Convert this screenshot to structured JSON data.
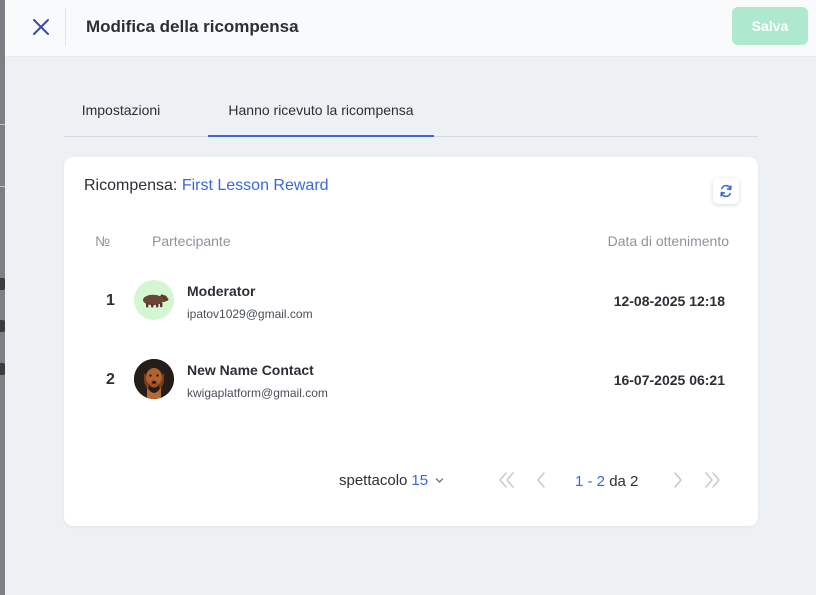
{
  "header": {
    "title": "Modifica della ricompensa",
    "save_label": "Salva"
  },
  "tabs": [
    {
      "label": "Impostazioni",
      "active": false
    },
    {
      "label": "Hanno ricevuto la ricompensa",
      "active": true
    }
  ],
  "reward": {
    "label": "Ricompensa:",
    "name": "First Lesson Reward"
  },
  "table": {
    "columns": {
      "number": "№",
      "participant": "Partecipante",
      "date": "Data di ottenimento"
    },
    "rows": [
      {
        "number": "1",
        "name": "Moderator",
        "email": "ipatov1029@gmail.com",
        "date": "12-08-2025 12:18",
        "avatar": "capybara-avatar"
      },
      {
        "number": "2",
        "name": "New Name Contact",
        "email": "kwigaplatform@gmail.com",
        "date": "16-07-2025 06:21",
        "avatar": "dog-photo-avatar"
      }
    ]
  },
  "pagination": {
    "per_page_label": "spettacolo",
    "per_page_value": "15",
    "range": "1 - 2",
    "of_label": "da",
    "total": "2"
  },
  "icons": {
    "close": "close-icon",
    "refresh": "refresh-icon",
    "first": "double-chevron-left-icon",
    "prev": "chevron-left-icon",
    "next": "chevron-right-icon",
    "last": "double-chevron-right-icon",
    "dropdown": "chevron-down-icon"
  },
  "colors": {
    "accent": "#3b67d9",
    "save_disabled": "#aee9cf",
    "background": "#eef1f4"
  }
}
